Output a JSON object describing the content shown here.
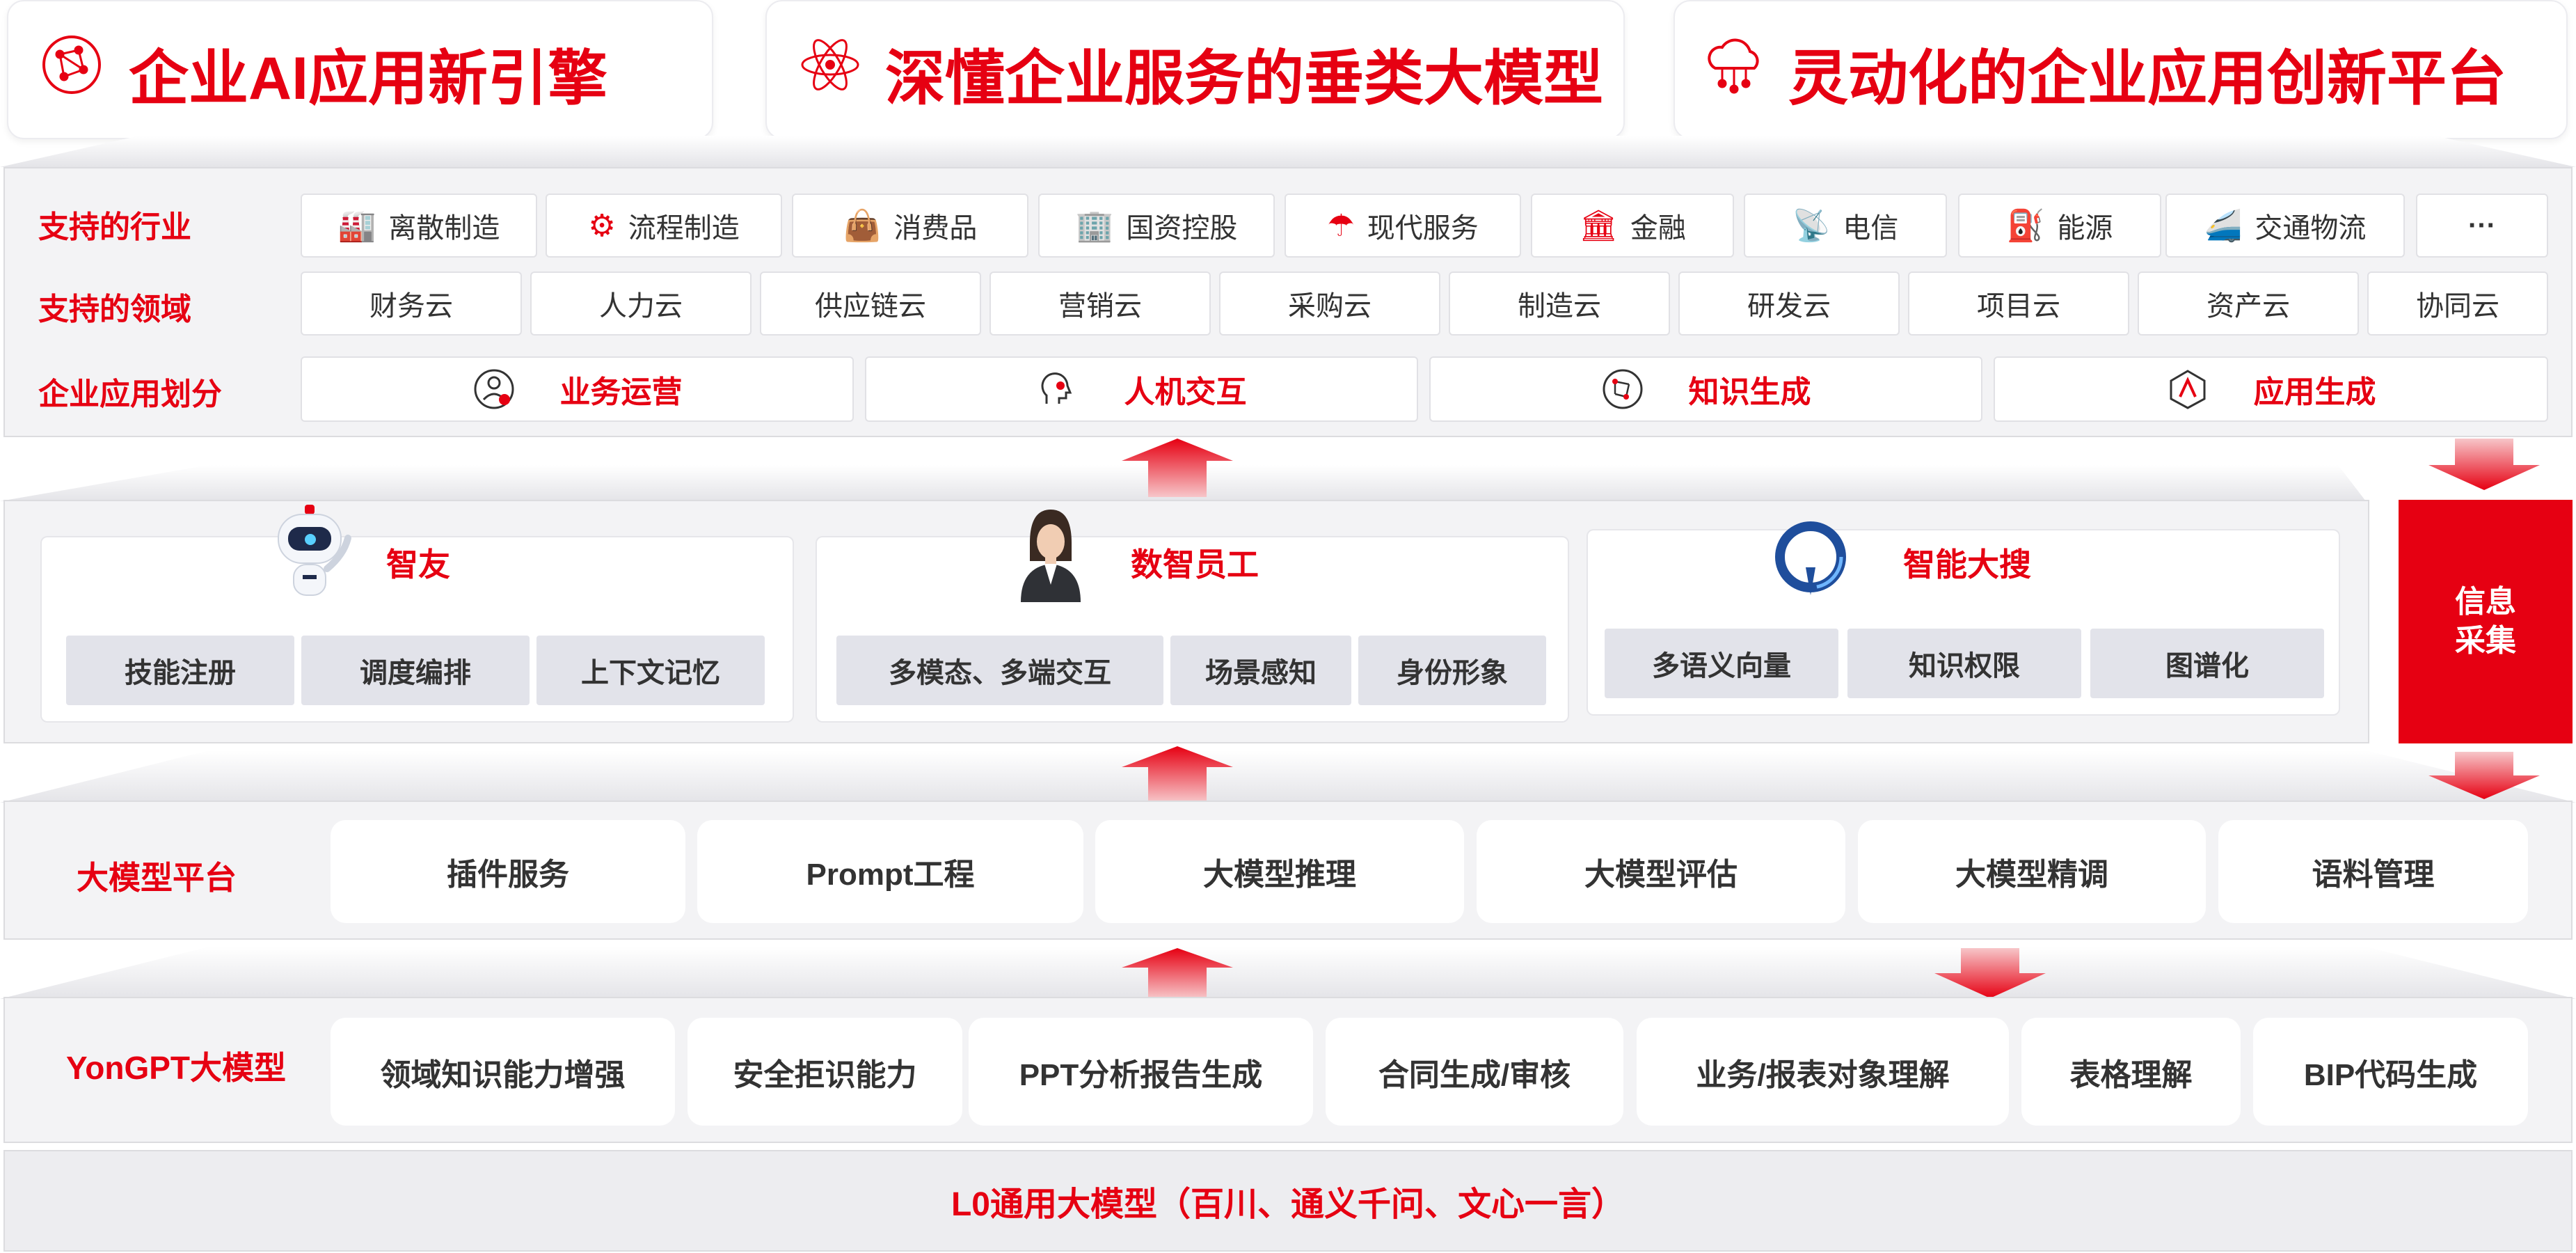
{
  "header": {
    "items": [
      {
        "icon": "network-icon",
        "title": "企业AI应用新引擎"
      },
      {
        "icon": "atom-icon",
        "title": "深懂企业服务的垂类大模型"
      },
      {
        "icon": "cloud-network-icon",
        "title": "灵动化的企业应用创新平台"
      }
    ]
  },
  "industries": {
    "label": "支持的行业",
    "items": [
      {
        "icon": "factory-icon",
        "label": "离散制造"
      },
      {
        "icon": "robot-arm-icon",
        "label": "流程制造"
      },
      {
        "icon": "shopping-bag-icon",
        "label": "消费品"
      },
      {
        "icon": "building-icon",
        "label": "国资控股"
      },
      {
        "icon": "umbrella-icon",
        "label": "现代服务"
      },
      {
        "icon": "bank-icon",
        "label": "金融"
      },
      {
        "icon": "antenna-icon",
        "label": "电信"
      },
      {
        "icon": "oil-pump-icon",
        "label": "能源"
      },
      {
        "icon": "train-icon",
        "label": "交通物流"
      },
      {
        "icon": "more-icon",
        "label": "···"
      }
    ]
  },
  "domains": {
    "label": "支持的领域",
    "items": [
      "财务云",
      "人力云",
      "供应链云",
      "营销云",
      "采购云",
      "制造云",
      "研发云",
      "项目云",
      "资产云",
      "协同云"
    ]
  },
  "categories": {
    "label": "企业应用划分",
    "items": [
      {
        "icon": "operations-icon",
        "label": "业务运营"
      },
      {
        "icon": "human-ai-icon",
        "label": "人机交互"
      },
      {
        "icon": "knowledge-icon",
        "label": "知识生成"
      },
      {
        "icon": "app-generate-icon",
        "label": "应用生成"
      }
    ]
  },
  "apps": [
    {
      "icon": "robot-mascot-icon",
      "title": "智友",
      "features": [
        "技能注册",
        "调度编排",
        "上下文记忆"
      ]
    },
    {
      "icon": "digital-employee-icon",
      "title": "数智员工",
      "features": [
        "多模态、多端交互",
        "场景感知",
        "身份形象"
      ]
    },
    {
      "icon": "smart-search-icon",
      "title": "智能大搜",
      "features": [
        "多语义向量",
        "知识权限",
        "图谱化"
      ]
    }
  ],
  "info_collect": {
    "line1": "信息",
    "line2": "采集"
  },
  "platform": {
    "label": "大模型平台",
    "items": [
      "插件服务",
      "Prompt工程",
      "大模型推理",
      "大模型评估",
      "大模型精调",
      "语料管理"
    ]
  },
  "yongpt": {
    "label": "YonGPT大模型",
    "items": [
      "领域知识能力增强",
      "安全拒识能力",
      "PPT分析报告生成",
      "合同生成/审核",
      "业务/报表对象理解",
      "表格理解",
      "BIP代码生成"
    ]
  },
  "base_model": {
    "label": "L0通用大模型（百川、通义千问、文心一言）"
  },
  "colors": {
    "accent": "#e60012",
    "band": "#f3f3f5",
    "feature_box": "#e2e3ea",
    "text": "#333333"
  }
}
